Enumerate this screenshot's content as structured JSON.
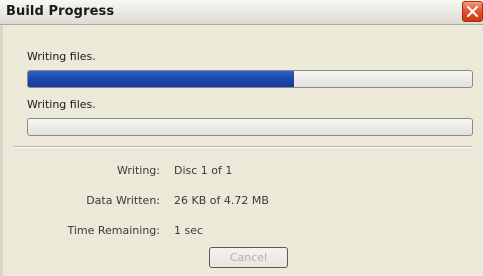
{
  "window": {
    "title": "Build Progress",
    "close_icon": "close-x-icon"
  },
  "progress": [
    {
      "label": "Writing files.",
      "fraction": 0.6
    },
    {
      "label": "Writing files.",
      "fraction": 0.0
    }
  ],
  "info": {
    "writing_label": "Writing:",
    "writing_value": "Disc 1 of 1",
    "data_written_label": "Data Written:",
    "data_written_value": "26 KB of 4.72 MB",
    "time_remaining_label": "Time Remaining:",
    "time_remaining_value": "1 sec"
  },
  "buttons": {
    "cancel_label": "Cancel",
    "cancel_enabled": false
  },
  "colors": {
    "progress_fill": "#1d4bb0",
    "close_button": "#e0522c"
  }
}
